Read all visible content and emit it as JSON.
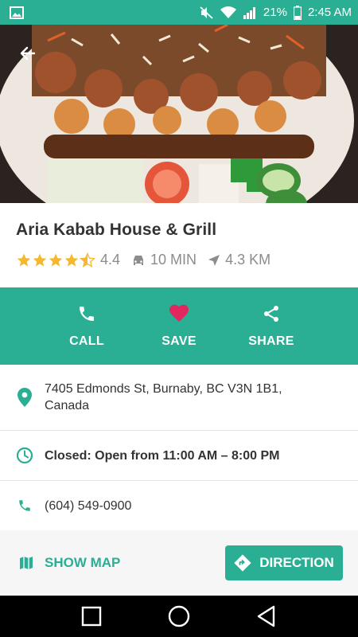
{
  "status_bar": {
    "battery": "21%",
    "time": "2:45 AM",
    "icons": [
      "image-icon",
      "mute-icon",
      "wifi-icon",
      "signal-icon",
      "battery-icon"
    ]
  },
  "place": {
    "name": "Aria Kabab House & Grill",
    "rating": "4.4",
    "rating_value": 4.4,
    "drive_time": "10 MIN",
    "distance": "4.3 KM"
  },
  "actions": {
    "call": "CALL",
    "save": "SAVE",
    "share": "SHARE"
  },
  "details": {
    "address_line1": "7405 Edmonds St, Burnaby, BC V3N 1B1,",
    "address_line2": "Canada",
    "hours": "Closed: Open from  11:00 AM – 8:00 PM",
    "phone": "(604) 549-0900"
  },
  "bottom": {
    "show_map": "SHOW MAP",
    "direction": "DIRECTION"
  },
  "colors": {
    "accent": "#2aaf94",
    "star": "#f5b82e",
    "heart": "#e2265f"
  }
}
